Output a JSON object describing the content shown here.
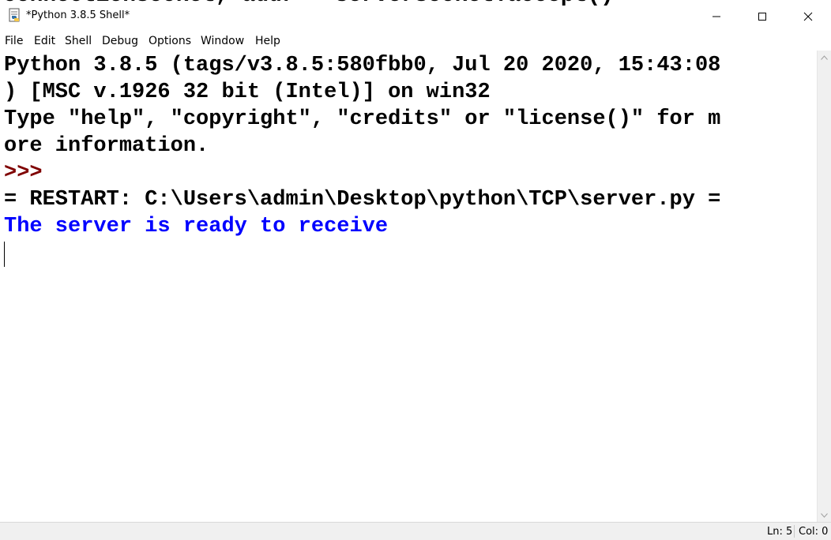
{
  "window": {
    "title": "*Python 3.8.5 Shell*",
    "background_text": "connectionSocket, addr = serverSocket.accept()"
  },
  "menu": [
    "File",
    "Edit",
    "Shell",
    "Debug",
    "Options",
    "Window",
    "Help"
  ],
  "shell": {
    "lines": [
      {
        "text": "Python 3.8.5 (tags/v3.8.5:580fbb0, Jul 20 2020, 15:43:08",
        "kind": "normal"
      },
      {
        "text": ") [MSC v.1926 32 bit (Intel)] on win32",
        "kind": "normal"
      },
      {
        "text": "Type \"help\", \"copyright\", \"credits\" or \"license()\" for m",
        "kind": "normal"
      },
      {
        "text": "ore information.",
        "kind": "normal"
      },
      {
        "text": ">>>",
        "kind": "prompt"
      },
      {
        "text": "= RESTART: C:\\Users\\admin\\Desktop\\python\\TCP\\server.py =",
        "kind": "normal"
      },
      {
        "text": "The server is ready to receive",
        "kind": "stdout"
      }
    ]
  },
  "status": {
    "line": "Ln: 5",
    "col": "Col: 0"
  },
  "colors": {
    "prompt": "#7f0000",
    "stdout": "#0000ff",
    "text": "#000000"
  },
  "icons": {
    "app": "idle-python-icon",
    "minimize": "minimize-icon",
    "maximize": "maximize-icon",
    "close": "close-icon"
  }
}
